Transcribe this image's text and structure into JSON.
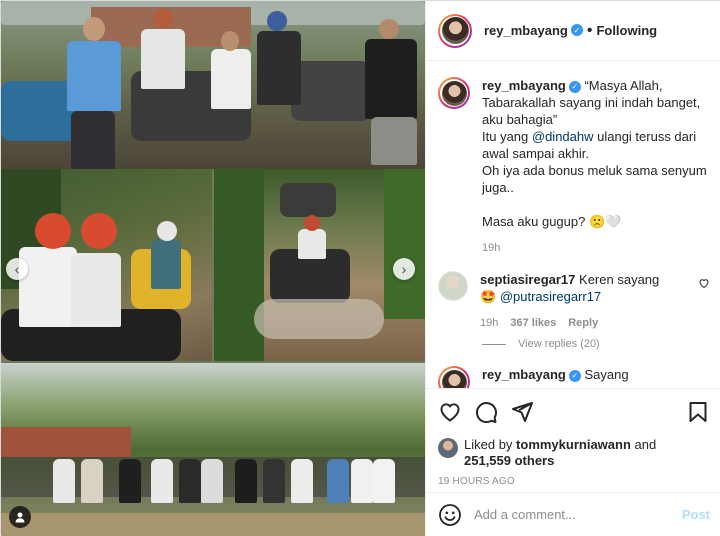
{
  "post": {
    "author": "rey_mbayang",
    "following_label": "Following",
    "caption": {
      "quote": "“Masya Allah, Tabarakallah sayang ini indah banget, aku bahagia”",
      "line1_prefix": "Itu yang ",
      "mention": "@dindahw",
      "line1_suffix": " ulangi teruss dari awal sampai akhir.",
      "line2": "Oh iya ada bonus meluk sama senyum juga..",
      "line3": "Masa aku gugup? 🙁🤍",
      "time": "19h"
    },
    "reply": {
      "author": "septiasiregar17",
      "text": "Keren sayang",
      "emoji": "🤩",
      "mention": "@putrasiregarr17",
      "time": "19h",
      "likes": "367 likes",
      "reply_label": "Reply",
      "view_replies": "View replies (20)"
    },
    "partial_comment": {
      "author": "rey_mbayang",
      "text": "Sayang"
    },
    "liked_by_prefix": "Liked by ",
    "liked_by_user": "tommykurniawann",
    "liked_by_and": " and",
    "liked_by_count": "251,559 others",
    "timestamp": "19 HOURS AGO",
    "comment_placeholder": "Add a comment...",
    "post_label": "Post"
  },
  "colors": {
    "link": "#00376b",
    "verified": "#3897f0",
    "muted": "#8e8e8e",
    "post_disabled": "#b2dffc"
  },
  "icons": {
    "like": "heart-icon",
    "comment": "comment-icon",
    "share": "paper-plane-icon",
    "save": "bookmark-icon",
    "emoji": "smiley-icon",
    "prev": "chevron-left-icon",
    "next": "chevron-right-icon",
    "tag": "user-tag-icon"
  }
}
